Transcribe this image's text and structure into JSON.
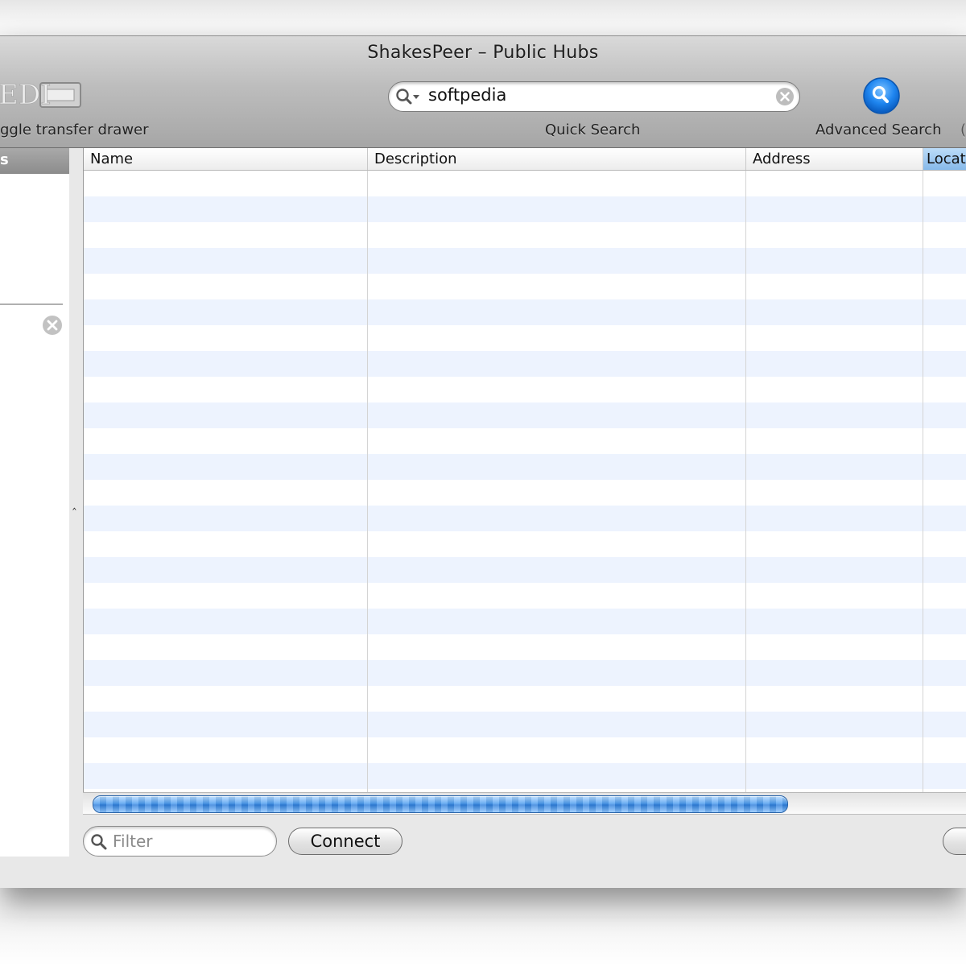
{
  "window": {
    "title": "ShakesPeer – Public Hubs"
  },
  "toolbar": {
    "transfer_label": "ggle transfer drawer",
    "quick_search": {
      "value": "softpedia",
      "label": "Quick Search"
    },
    "advanced_search": {
      "label": "Advanced Search",
      "icon": "magnifier-icon"
    },
    "logo_text": "EDI"
  },
  "sidebar": {
    "header": "s"
  },
  "table": {
    "columns": [
      "Name",
      "Description",
      "Address",
      "Locat"
    ],
    "selected_column": "Locat",
    "rows": []
  },
  "footer": {
    "filter_placeholder": "Filter",
    "connect_label": "Connect"
  },
  "colors": {
    "row_alt": "#edf3fe",
    "accent": "#2f7fdb"
  }
}
